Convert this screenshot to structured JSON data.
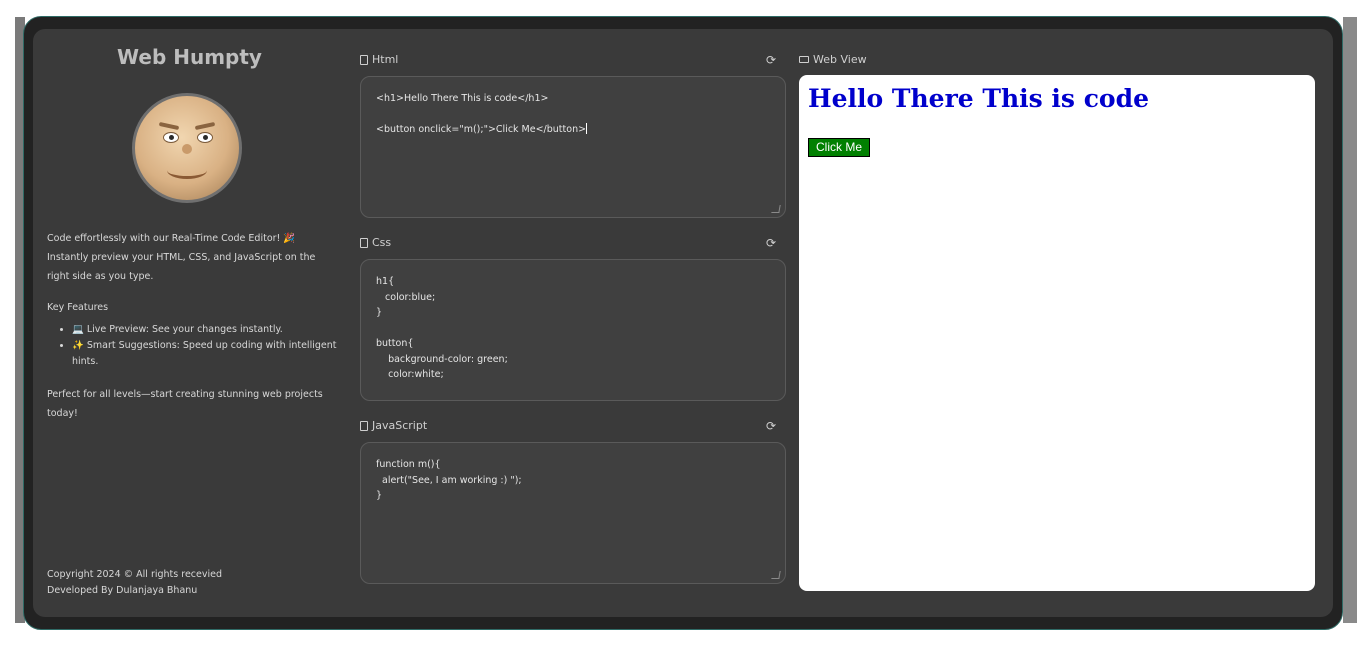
{
  "sidebar": {
    "title": "Web Humpty",
    "description": "Code effortlessly with our Real-Time Code Editor! 🎉 Instantly preview your HTML, CSS, and JavaScript on the right side as you type.",
    "key_features_title": "Key Features",
    "features": [
      "💻 Live Preview: See your changes instantly.",
      "✨ Smart Suggestions: Speed up coding with intelligent hints."
    ],
    "closing": "Perfect for all levels—start creating stunning web projects today!",
    "copyright": "Copyright 2024 © All rights recevied",
    "developer": "Developed By Dulanjaya Bhanu"
  },
  "editors": {
    "html": {
      "label": "Html",
      "code": "<h1>Hello There This is code</h1>\n\n<button onclick=\"m();\">Click Me</button>"
    },
    "css": {
      "label": "Css",
      "code": "h1{\n   color:blue;\n}\n\nbutton{\n    background-color: green;\n    color:white;"
    },
    "js": {
      "label": "JavaScript",
      "code": "function m(){\n  alert(\"See, I am working :) \");\n}"
    }
  },
  "webview": {
    "label": "Web View",
    "heading": "Hello There This is code",
    "button_label": "Click Me",
    "heading_color": "#0000cc",
    "button_bg": "#008000"
  },
  "icons": {
    "editor_icon": "document-icon",
    "refresh_icon": "refresh-icon",
    "webview_icon": "monitor-icon"
  }
}
